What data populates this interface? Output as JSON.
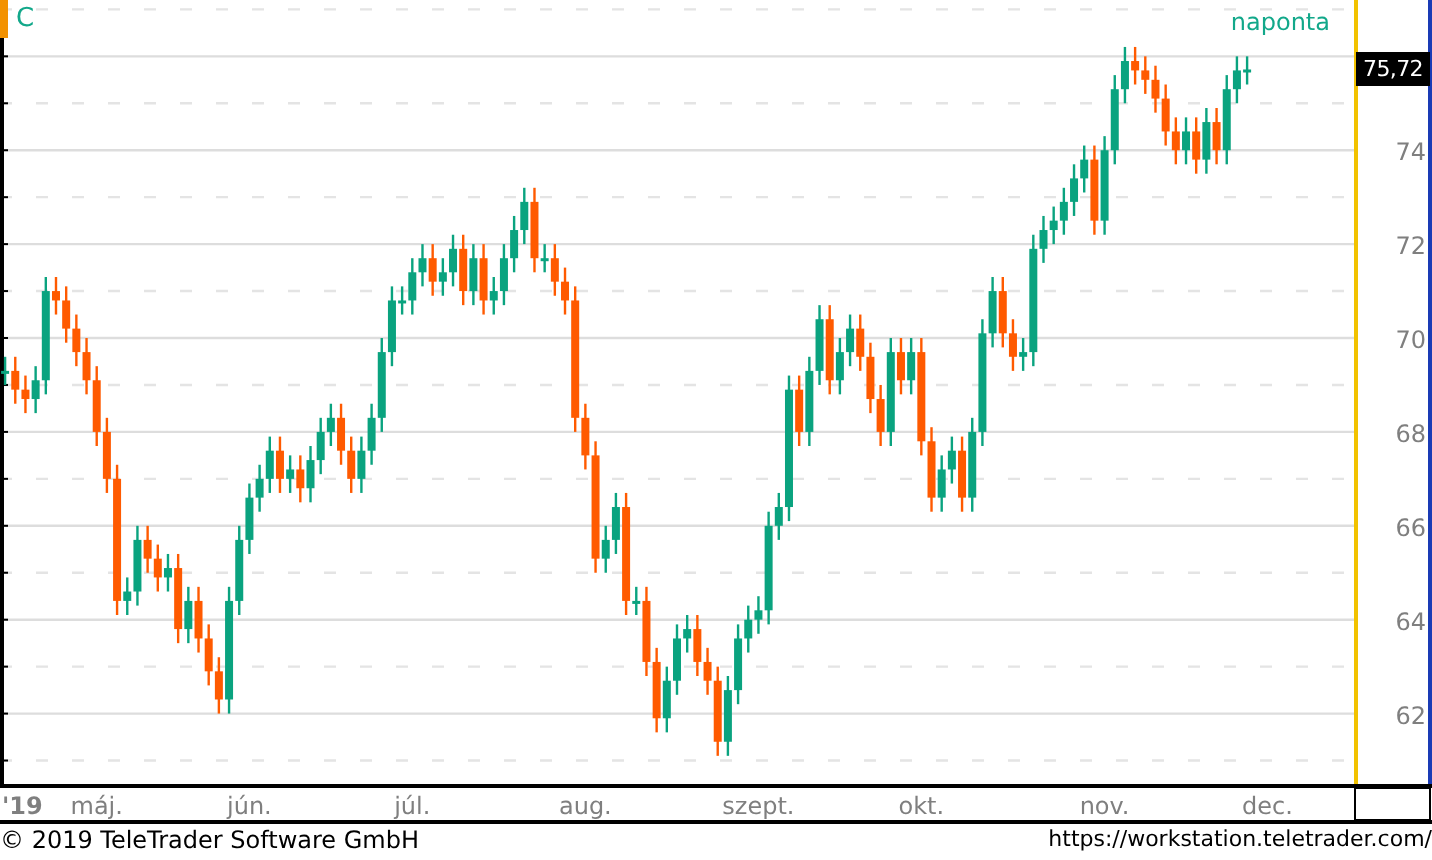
{
  "chart": {
    "interval": "naponta",
    "last_price": "75,72",
    "year_label": "'19",
    "chart_data": {
      "type": "candlestick",
      "title": "C",
      "ylim": [
        60.5,
        77.2
      ],
      "grid": true,
      "yticks": [
        62,
        64,
        66,
        68,
        70,
        72,
        74
      ],
      "categories": [
        null,
        null,
        null,
        null,
        null,
        null,
        null,
        null,
        null,
        "máj.",
        null,
        null,
        null,
        null,
        null,
        null,
        null,
        null,
        null,
        null,
        null,
        null,
        null,
        null,
        "jún.",
        null,
        null,
        null,
        null,
        null,
        null,
        null,
        null,
        null,
        null,
        null,
        null,
        null,
        null,
        null,
        "júl.",
        null,
        null,
        null,
        null,
        null,
        null,
        null,
        null,
        null,
        null,
        null,
        null,
        null,
        null,
        null,
        null,
        "aug.",
        null,
        null,
        null,
        null,
        null,
        null,
        null,
        null,
        null,
        null,
        null,
        null,
        null,
        null,
        null,
        null,
        "szept.",
        null,
        null,
        null,
        null,
        null,
        null,
        null,
        null,
        null,
        null,
        null,
        null,
        null,
        null,
        null,
        "okt.",
        null,
        null,
        null,
        null,
        null,
        null,
        null,
        null,
        null,
        null,
        null,
        null,
        null,
        null,
        null,
        null,
        null,
        "nov.",
        null,
        null,
        null,
        null,
        null,
        null,
        null,
        null,
        null,
        null,
        null,
        null,
        null,
        null,
        null,
        "dec.",
        null,
        null,
        null,
        null,
        null,
        null,
        null,
        null
      ],
      "ohlc": [
        [
          69.3,
          69.6,
          69.0,
          69.3
        ],
        [
          69.3,
          69.6,
          68.6,
          68.9
        ],
        [
          68.9,
          69.2,
          68.4,
          68.7
        ],
        [
          68.7,
          69.4,
          68.4,
          69.1
        ],
        [
          69.1,
          71.3,
          68.8,
          71.0
        ],
        [
          71.0,
          71.3,
          70.5,
          70.8
        ],
        [
          70.8,
          71.1,
          69.9,
          70.2
        ],
        [
          70.2,
          70.5,
          69.4,
          69.7
        ],
        [
          69.7,
          70.0,
          68.8,
          69.1
        ],
        [
          69.1,
          69.4,
          67.7,
          68.0
        ],
        [
          68.0,
          68.3,
          66.7,
          67.0
        ],
        [
          67.0,
          67.3,
          64.1,
          64.4
        ],
        [
          64.4,
          64.9,
          64.1,
          64.6
        ],
        [
          64.6,
          66.0,
          64.3,
          65.7
        ],
        [
          65.7,
          66.0,
          65.0,
          65.3
        ],
        [
          65.3,
          65.6,
          64.6,
          64.9
        ],
        [
          64.9,
          65.4,
          64.6,
          65.1
        ],
        [
          65.1,
          65.4,
          63.5,
          63.8
        ],
        [
          63.8,
          64.7,
          63.5,
          64.4
        ],
        [
          64.4,
          64.7,
          63.3,
          63.6
        ],
        [
          63.6,
          63.9,
          62.6,
          62.9
        ],
        [
          62.9,
          63.2,
          62.0,
          62.3
        ],
        [
          62.3,
          64.7,
          62.0,
          64.4
        ],
        [
          64.4,
          66.0,
          64.1,
          65.7
        ],
        [
          65.7,
          66.9,
          65.4,
          66.6
        ],
        [
          66.6,
          67.3,
          66.3,
          67.0
        ],
        [
          67.0,
          67.9,
          66.7,
          67.6
        ],
        [
          67.6,
          67.9,
          66.7,
          67.0
        ],
        [
          67.0,
          67.5,
          66.7,
          67.2
        ],
        [
          67.2,
          67.5,
          66.5,
          66.8
        ],
        [
          66.8,
          67.7,
          66.5,
          67.4
        ],
        [
          67.4,
          68.3,
          67.1,
          68.0
        ],
        [
          68.0,
          68.6,
          67.7,
          68.3
        ],
        [
          68.3,
          68.6,
          67.3,
          67.6
        ],
        [
          67.6,
          67.9,
          66.7,
          67.0
        ],
        [
          67.0,
          67.9,
          66.7,
          67.6
        ],
        [
          67.6,
          68.6,
          67.3,
          68.3
        ],
        [
          68.3,
          70.0,
          68.0,
          69.7
        ],
        [
          69.7,
          71.1,
          69.4,
          70.8
        ],
        [
          70.8,
          71.1,
          70.5,
          70.8
        ],
        [
          70.8,
          71.7,
          70.5,
          71.4
        ],
        [
          71.4,
          72.0,
          71.1,
          71.7
        ],
        [
          71.7,
          72.0,
          70.9,
          71.2
        ],
        [
          71.2,
          71.7,
          70.9,
          71.4
        ],
        [
          71.4,
          72.2,
          71.1,
          71.9
        ],
        [
          71.9,
          72.2,
          70.7,
          71.0
        ],
        [
          71.0,
          72.0,
          70.7,
          71.7
        ],
        [
          71.7,
          72.0,
          70.5,
          70.8
        ],
        [
          70.8,
          71.3,
          70.5,
          71.0
        ],
        [
          71.0,
          72.0,
          70.7,
          71.7
        ],
        [
          71.7,
          72.6,
          71.4,
          72.3
        ],
        [
          72.3,
          73.2,
          72.0,
          72.9
        ],
        [
          72.9,
          73.2,
          71.4,
          71.7
        ],
        [
          71.7,
          72.0,
          71.4,
          71.7
        ],
        [
          71.7,
          72.0,
          70.9,
          71.2
        ],
        [
          71.2,
          71.5,
          70.5,
          70.8
        ],
        [
          70.8,
          71.1,
          68.0,
          68.3
        ],
        [
          68.3,
          68.6,
          67.2,
          67.5
        ],
        [
          67.5,
          67.8,
          65.0,
          65.3
        ],
        [
          65.3,
          66.0,
          65.0,
          65.7
        ],
        [
          65.7,
          66.7,
          65.4,
          66.4
        ],
        [
          66.4,
          66.7,
          64.1,
          64.4
        ],
        [
          64.4,
          64.7,
          64.1,
          64.4
        ],
        [
          64.4,
          64.7,
          62.8,
          63.1
        ],
        [
          63.1,
          63.4,
          61.6,
          61.9
        ],
        [
          61.9,
          63.0,
          61.6,
          62.7
        ],
        [
          62.7,
          63.9,
          62.4,
          63.6
        ],
        [
          63.6,
          64.1,
          63.3,
          63.8
        ],
        [
          63.8,
          64.1,
          62.8,
          63.1
        ],
        [
          63.1,
          63.4,
          62.4,
          62.7
        ],
        [
          62.7,
          63.0,
          61.1,
          61.4
        ],
        [
          61.4,
          62.8,
          61.1,
          62.5
        ],
        [
          62.5,
          63.9,
          62.2,
          63.6
        ],
        [
          63.6,
          64.3,
          63.3,
          64.0
        ],
        [
          64.0,
          64.5,
          63.7,
          64.2
        ],
        [
          64.2,
          66.3,
          63.9,
          66.0
        ],
        [
          66.0,
          66.7,
          65.7,
          66.4
        ],
        [
          66.4,
          69.2,
          66.1,
          68.9
        ],
        [
          68.9,
          69.2,
          67.7,
          68.0
        ],
        [
          68.0,
          69.6,
          67.7,
          69.3
        ],
        [
          69.3,
          70.7,
          69.0,
          70.4
        ],
        [
          70.4,
          70.7,
          68.8,
          69.1
        ],
        [
          69.1,
          70.0,
          68.8,
          69.7
        ],
        [
          69.7,
          70.5,
          69.4,
          70.2
        ],
        [
          70.2,
          70.5,
          69.3,
          69.6
        ],
        [
          69.6,
          69.9,
          68.4,
          68.7
        ],
        [
          68.7,
          69.0,
          67.7,
          68.0
        ],
        [
          68.0,
          70.0,
          67.7,
          69.7
        ],
        [
          69.7,
          70.0,
          68.8,
          69.1
        ],
        [
          69.1,
          70.0,
          68.8,
          69.7
        ],
        [
          69.7,
          70.0,
          67.5,
          67.8
        ],
        [
          67.8,
          68.1,
          66.3,
          66.6
        ],
        [
          66.6,
          67.5,
          66.3,
          67.2
        ],
        [
          67.2,
          67.9,
          66.9,
          67.6
        ],
        [
          67.6,
          67.9,
          66.3,
          66.6
        ],
        [
          66.6,
          68.3,
          66.3,
          68.0
        ],
        [
          68.0,
          70.4,
          67.7,
          70.1
        ],
        [
          70.1,
          71.3,
          69.8,
          71.0
        ],
        [
          71.0,
          71.3,
          69.8,
          70.1
        ],
        [
          70.1,
          70.4,
          69.3,
          69.6
        ],
        [
          69.6,
          70.0,
          69.3,
          69.7
        ],
        [
          69.7,
          72.2,
          69.4,
          71.9
        ],
        [
          71.9,
          72.6,
          71.6,
          72.3
        ],
        [
          72.3,
          72.8,
          72.0,
          72.5
        ],
        [
          72.5,
          73.2,
          72.2,
          72.9
        ],
        [
          72.9,
          73.7,
          72.6,
          73.4
        ],
        [
          73.4,
          74.1,
          73.1,
          73.8
        ],
        [
          73.8,
          74.1,
          72.2,
          72.5
        ],
        [
          72.5,
          74.3,
          72.2,
          74.0
        ],
        [
          74.0,
          75.6,
          73.7,
          75.3
        ],
        [
          75.3,
          76.2,
          75.0,
          75.9
        ],
        [
          75.9,
          76.2,
          75.4,
          75.7
        ],
        [
          75.7,
          76.0,
          75.2,
          75.5
        ],
        [
          75.5,
          75.8,
          74.8,
          75.1
        ],
        [
          75.1,
          75.4,
          74.1,
          74.4
        ],
        [
          74.4,
          74.7,
          73.7,
          74.0
        ],
        [
          74.0,
          74.7,
          73.7,
          74.4
        ],
        [
          74.4,
          74.7,
          73.5,
          73.8
        ],
        [
          73.8,
          74.9,
          73.5,
          74.6
        ],
        [
          74.6,
          74.9,
          73.7,
          74.0
        ],
        [
          74.0,
          75.6,
          73.7,
          75.3
        ],
        [
          75.3,
          76.0,
          75.0,
          75.7
        ],
        [
          75.7,
          76.0,
          75.4,
          75.72
        ],
        null,
        null,
        null,
        null,
        null,
        null,
        null,
        null,
        null,
        null
      ]
    }
  },
  "footer": {
    "copyright": "© 2019 TeleTrader Software GmbH",
    "url": "https://workstation.teletrader.com/"
  }
}
